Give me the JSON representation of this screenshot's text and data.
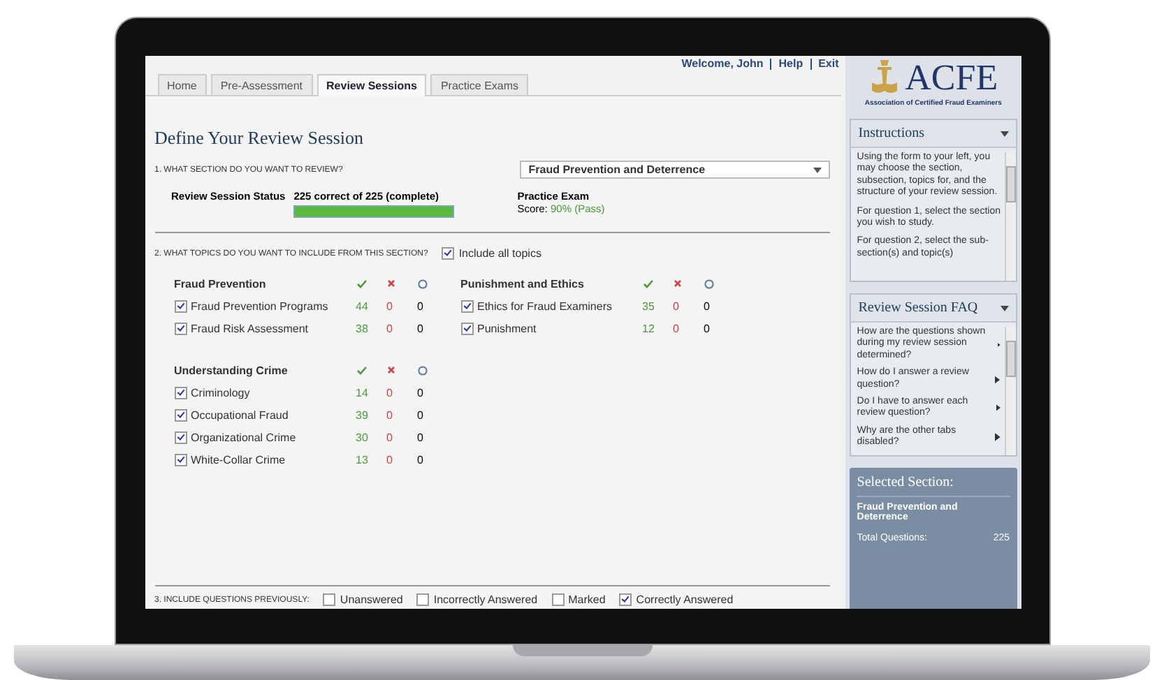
{
  "header": {
    "welcome": "Welcome, John",
    "links": [
      "Help",
      "Exit"
    ]
  },
  "tabs": [
    {
      "label": "Home",
      "selected": false
    },
    {
      "label": "Pre-Assessment",
      "selected": false
    },
    {
      "label": "Review Sessions",
      "selected": true
    },
    {
      "label": "Practice Exams",
      "selected": false
    }
  ],
  "page_title": "Define Your Review Session",
  "question_1": {
    "label": "1. WHAT SECTION DO YOU WANT TO REVIEW?",
    "dropdown": "Fraud Prevention and Deterrence"
  },
  "status": {
    "label": "Review Session Status",
    "text": "225 correct of 225 (complete)",
    "level": 1
  },
  "practice_exam": {
    "title": "Practice Exam",
    "score_label": "Score:",
    "score_value": "90% (Pass)"
  },
  "question_2": {
    "label": "2. WHAT TOPICS DO YOU WANT TO INCLUDE FROM THIS SECTION?",
    "include_all": {
      "label": "Include all topics",
      "checked": true
    }
  },
  "groups": [
    {
      "title": "Fraud Prevention",
      "topics": [
        {
          "name": "Fraud Prevention Programs",
          "checked": true,
          "correct": "44",
          "incorrect": "0",
          "unanswered": "0"
        },
        {
          "name": "Fraud Risk Assessment",
          "checked": true,
          "correct": "38",
          "incorrect": "0",
          "unanswered": "0"
        }
      ]
    },
    {
      "title": "Punishment and Ethics",
      "topics": [
        {
          "name": "Ethics for Fraud Examiners",
          "checked": true,
          "correct": "35",
          "incorrect": "0",
          "unanswered": "0"
        },
        {
          "name": "Punishment",
          "checked": true,
          "correct": "12",
          "incorrect": "0",
          "unanswered": "0"
        }
      ]
    },
    {
      "title": "Understanding Crime",
      "topics": [
        {
          "name": "Criminology",
          "checked": true,
          "correct": "14",
          "incorrect": "0",
          "unanswered": "0"
        },
        {
          "name": "Occupational Fraud",
          "checked": true,
          "correct": "39",
          "incorrect": "0",
          "unanswered": "0"
        },
        {
          "name": "Organizational Crime",
          "checked": true,
          "correct": "30",
          "incorrect": "0",
          "unanswered": "0"
        },
        {
          "name": "White-Collar Crime",
          "checked": true,
          "correct": "13",
          "incorrect": "0",
          "unanswered": "0"
        }
      ]
    }
  ],
  "question_3": {
    "label": "3. INCLUDE QUESTIONS PREVIOUSLY:",
    "options": [
      {
        "label": "Unanswered",
        "checked": false
      },
      {
        "label": "Incorrectly Answered",
        "checked": false
      },
      {
        "label": "Marked",
        "checked": false
      },
      {
        "label": "Correctly Answered",
        "checked": true
      }
    ]
  },
  "sidebar": {
    "logo": {
      "name": "ACFE",
      "subtitle": "Association of Certified Fraud Examiners"
    },
    "instructions": {
      "title": "Instructions",
      "paragraphs": [
        "Using the form to your left, you may choose the section, subsection, topics for, and the structure of your review session.",
        "For question 1, select the section you wish to study.",
        "For question 2, select the sub-section(s) and topic(s)"
      ]
    },
    "faq": {
      "title": "Review Session FAQ",
      "items": [
        "How are the questions shown during my review session determined?",
        "How do I answer a review question?",
        "Do I have to answer each review question?",
        "Why are the other tabs disabled?"
      ]
    },
    "selected_section": {
      "title": "Selected Section:",
      "name": "Fraud Prevention and Deterrence",
      "total_label": "Total Questions:",
      "total_value": "225"
    }
  }
}
